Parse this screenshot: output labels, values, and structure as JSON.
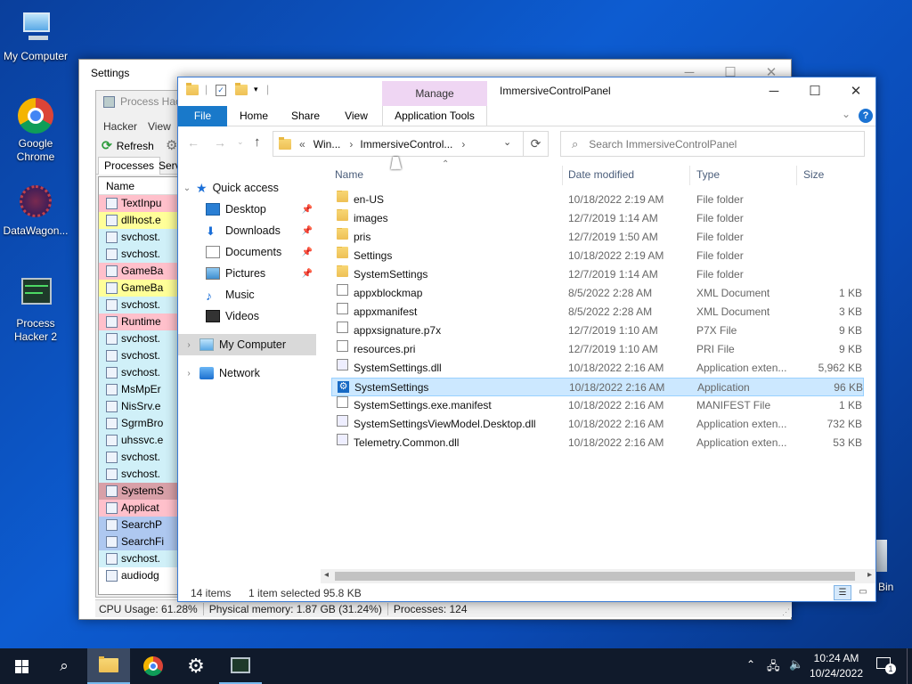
{
  "desktop": {
    "icons": [
      {
        "label": "My Computer",
        "icon": "computer-icon"
      },
      {
        "label": "Google Chrome",
        "icon": "chrome-icon"
      },
      {
        "label": "DataWagon...",
        "icon": "datawagon-icon"
      },
      {
        "label": "Process Hacker 2",
        "icon": "process-hacker-icon"
      }
    ],
    "recycle_partial": "Bin"
  },
  "settings_window": {
    "title": "Settings"
  },
  "process_hacker": {
    "title": "Process Hac",
    "menu": [
      "Hacker",
      "View"
    ],
    "refresh_label": "Refresh",
    "tabs": [
      "Processes",
      "Serv"
    ],
    "column_name": "Name",
    "rows": [
      {
        "name": "TextInpu",
        "color": "#ffc0cb"
      },
      {
        "name": "dllhost.e",
        "color": "#ffff99"
      },
      {
        "name": "svchost.",
        "color": "#d0f0f8"
      },
      {
        "name": "svchost.",
        "color": "#d0f0f8"
      },
      {
        "name": "GameBa",
        "color": "#ffc0cb"
      },
      {
        "name": "GameBa",
        "color": "#ffff99"
      },
      {
        "name": "svchost.",
        "color": "#d0f0f8"
      },
      {
        "name": "Runtime",
        "color": "#ffc0cb"
      },
      {
        "name": "svchost.",
        "color": "#d0f0f8"
      },
      {
        "name": "svchost.",
        "color": "#d0f0f8"
      },
      {
        "name": "svchost.",
        "color": "#d0f0f8"
      },
      {
        "name": "MsMpEr",
        "color": "#d0f0f8"
      },
      {
        "name": "NisSrv.e",
        "color": "#d0f0f8"
      },
      {
        "name": "SgrmBro",
        "color": "#d0f0f8"
      },
      {
        "name": "uhssvc.e",
        "color": "#d0f0f8"
      },
      {
        "name": "svchost.",
        "color": "#d0f0f8"
      },
      {
        "name": "svchost.",
        "color": "#d0f0f8"
      },
      {
        "name": "SystemS",
        "color": "#d8a0a8"
      },
      {
        "name": "Applicat",
        "color": "#ffc0cb"
      },
      {
        "name": "SearchP",
        "color": "#aec8f0"
      },
      {
        "name": "SearchFi",
        "color": "#aec8f0"
      },
      {
        "name": "svchost.",
        "color": "#d0f0f8"
      },
      {
        "name": "audiodg",
        "color": "#ffffff"
      }
    ],
    "status": {
      "cpu": "CPU Usage: 61.28%",
      "memory": "Physical memory: 1.87 GB (31.24%)",
      "processes": "Processes: 124"
    }
  },
  "explorer": {
    "title": "ImmersiveControlPanel",
    "qat_separator": "|",
    "context_tab_group": "Manage",
    "ribbon_tabs": [
      "File",
      "Home",
      "Share",
      "View",
      "Application Tools"
    ],
    "address": {
      "overflow": "«",
      "crumbs": [
        "Win...",
        "ImmersiveControl..."
      ],
      "sep": "›"
    },
    "search_placeholder": "Search ImmersiveControlPanel",
    "nav": {
      "quick_access": "Quick access",
      "items": [
        "Desktop",
        "Downloads",
        "Documents",
        "Pictures",
        "Music",
        "Videos"
      ],
      "my_computer": "My Computer",
      "network": "Network"
    },
    "columns": {
      "name": "Name",
      "date": "Date modified",
      "type": "Type",
      "size": "Size"
    },
    "files": [
      {
        "name": "en-US",
        "date": "10/18/2022 2:19 AM",
        "type": "File folder",
        "size": "",
        "kind": "folder"
      },
      {
        "name": "images",
        "date": "12/7/2019 1:14 AM",
        "type": "File folder",
        "size": "",
        "kind": "folder"
      },
      {
        "name": "pris",
        "date": "12/7/2019 1:50 AM",
        "type": "File folder",
        "size": "",
        "kind": "folder"
      },
      {
        "name": "Settings",
        "date": "10/18/2022 2:19 AM",
        "type": "File folder",
        "size": "",
        "kind": "folder"
      },
      {
        "name": "SystemSettings",
        "date": "12/7/2019 1:14 AM",
        "type": "File folder",
        "size": "",
        "kind": "folder"
      },
      {
        "name": "appxblockmap",
        "date": "8/5/2022 2:28 AM",
        "type": "XML Document",
        "size": "1 KB",
        "kind": "xml"
      },
      {
        "name": "appxmanifest",
        "date": "8/5/2022 2:28 AM",
        "type": "XML Document",
        "size": "3 KB",
        "kind": "xml"
      },
      {
        "name": "appxsignature.p7x",
        "date": "12/7/2019 1:10 AM",
        "type": "P7X File",
        "size": "9 KB",
        "kind": "doc"
      },
      {
        "name": "resources.pri",
        "date": "12/7/2019 1:10 AM",
        "type": "PRI File",
        "size": "9 KB",
        "kind": "doc"
      },
      {
        "name": "SystemSettings.dll",
        "date": "10/18/2022 2:16 AM",
        "type": "Application exten...",
        "size": "5,962 KB",
        "kind": "dll"
      },
      {
        "name": "SystemSettings",
        "date": "10/18/2022 2:16 AM",
        "type": "Application",
        "size": "96 KB",
        "kind": "app",
        "selected": true
      },
      {
        "name": "SystemSettings.exe.manifest",
        "date": "10/18/2022 2:16 AM",
        "type": "MANIFEST File",
        "size": "1 KB",
        "kind": "doc"
      },
      {
        "name": "SystemSettingsViewModel.Desktop.dll",
        "date": "10/18/2022 2:16 AM",
        "type": "Application exten...",
        "size": "732 KB",
        "kind": "dll"
      },
      {
        "name": "Telemetry.Common.dll",
        "date": "10/18/2022 2:16 AM",
        "type": "Application exten...",
        "size": "53 KB",
        "kind": "dll"
      }
    ],
    "status": {
      "count": "14 items",
      "selection": "1 item selected",
      "size": "95.8 KB"
    }
  },
  "taskbar": {
    "time": "10:24 AM",
    "date": "10/24/2022",
    "notification_count": "1"
  }
}
